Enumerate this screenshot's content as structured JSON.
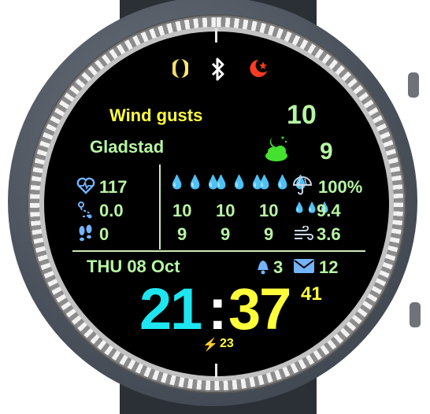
{
  "status_icons": [
    "moon-phase-icon",
    "bluetooth-icon",
    "moon-star-icon"
  ],
  "wind_gusts": {
    "label": "Wind gusts",
    "value": "10"
  },
  "location": {
    "name": "Gladstad",
    "weather_icon": "night-cloud-icon",
    "temperature": "9"
  },
  "left_stats": {
    "heart_rate": "117",
    "distance": "0.0",
    "steps": "0"
  },
  "forecast": {
    "upper_row": [
      "10",
      "10",
      "10"
    ],
    "lower_row": [
      "9",
      "9",
      "9"
    ]
  },
  "right_stats": {
    "precip_chance": "100%",
    "precip_amount": "9.4",
    "wind_speed": "3.6"
  },
  "date": "THU 08 Oct",
  "notifications": {
    "alerts": "3",
    "messages": "12"
  },
  "time": {
    "hours": "21",
    "separator": ":",
    "minutes": "37",
    "seconds": "41"
  },
  "battery": "23",
  "colors": {
    "green": "#b7f5a3",
    "yellow": "#ffff3a",
    "cyan": "#1ee6f0",
    "blue": "#73b4ff"
  }
}
